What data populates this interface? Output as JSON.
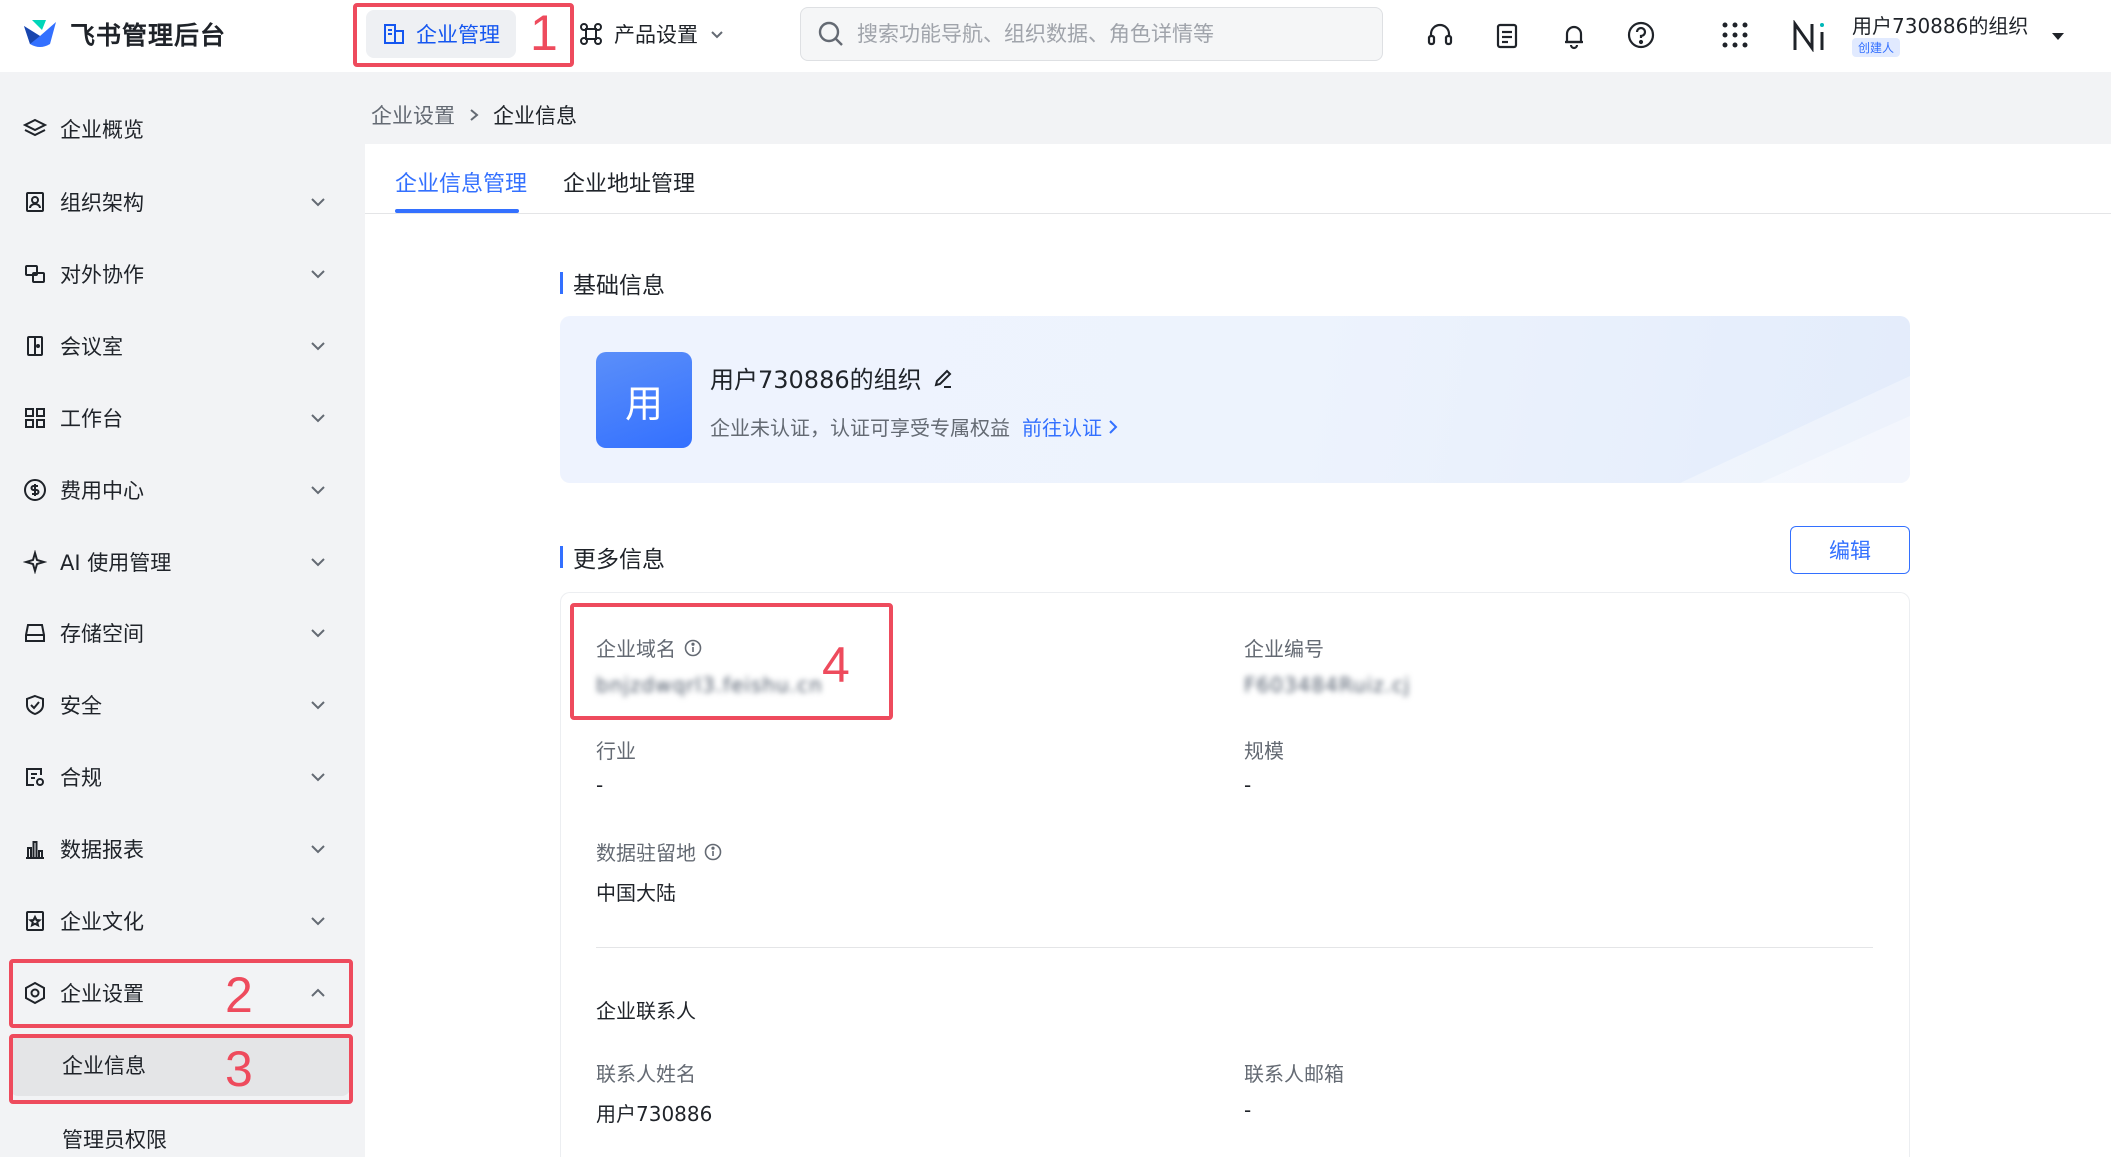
{
  "app": {
    "name": "飞书管理后台"
  },
  "topbar": {
    "tabs": [
      {
        "label": "企业管理",
        "active": true
      },
      {
        "label": "产品设置",
        "active": false
      }
    ],
    "search_placeholder": "搜索功能导航、组织数据、角色详情等",
    "icons": [
      "headset-icon",
      "clipboard-icon",
      "bell-icon",
      "help-icon",
      "apps-grid-icon"
    ],
    "org": {
      "name": "用户730886的组织",
      "role_badge": "创建人"
    }
  },
  "sidebar": {
    "items": [
      {
        "label": "企业概览",
        "icon": "layers-icon",
        "expandable": false
      },
      {
        "label": "组织架构",
        "icon": "contacts-icon",
        "expandable": true
      },
      {
        "label": "对外协作",
        "icon": "collab-icon",
        "expandable": true
      },
      {
        "label": "会议室",
        "icon": "door-icon",
        "expandable": true
      },
      {
        "label": "工作台",
        "icon": "grid-icon",
        "expandable": true
      },
      {
        "label": "费用中心",
        "icon": "dollar-icon",
        "expandable": true
      },
      {
        "label": "AI 使用管理",
        "icon": "sparkle-icon",
        "expandable": true
      },
      {
        "label": "存储空间",
        "icon": "storage-icon",
        "expandable": true
      },
      {
        "label": "安全",
        "icon": "shield-icon",
        "expandable": true
      },
      {
        "label": "合规",
        "icon": "compliance-icon",
        "expandable": true
      },
      {
        "label": "数据报表",
        "icon": "bar-chart-icon",
        "expandable": true
      },
      {
        "label": "企业文化",
        "icon": "culture-icon",
        "expandable": true
      },
      {
        "label": "企业设置",
        "icon": "settings-hex-icon",
        "expandable": true,
        "expanded": true
      }
    ],
    "sub_items": [
      {
        "label": "企业信息",
        "active": true
      },
      {
        "label": "管理员权限",
        "active": false
      }
    ]
  },
  "breadcrumb": {
    "parent": "企业设置",
    "current": "企业信息"
  },
  "tabs": [
    {
      "label": "企业信息管理",
      "active": true
    },
    {
      "label": "企业地址管理",
      "active": false
    }
  ],
  "basic_info": {
    "title": "基础信息",
    "avatar_char": "用",
    "org_name": "用户730886的组织",
    "cert_status": "企业未认证，认证可享受专属权益",
    "cert_link": "前往认证"
  },
  "more_info": {
    "title": "更多信息",
    "edit_label": "编辑",
    "fields": {
      "domain": {
        "label": "企业域名",
        "value": "bnjzdwqrl3.feishu.cn"
      },
      "number": {
        "label": "企业编号",
        "value": "F603484Ruiz.cj"
      },
      "industry": {
        "label": "行业",
        "value": "-"
      },
      "scale": {
        "label": "规模",
        "value": "-"
      },
      "residency": {
        "label": "数据驻留地",
        "value": "中国大陆"
      }
    },
    "contact": {
      "title": "企业联系人",
      "name_label": "联系人姓名",
      "name_value": "用户730886",
      "email_label": "联系人邮箱",
      "email_value": "-"
    }
  },
  "annotations": [
    "1",
    "2",
    "3",
    "4"
  ],
  "colors": {
    "accent": "#3370ff",
    "annotation": "#ee4b5d"
  }
}
